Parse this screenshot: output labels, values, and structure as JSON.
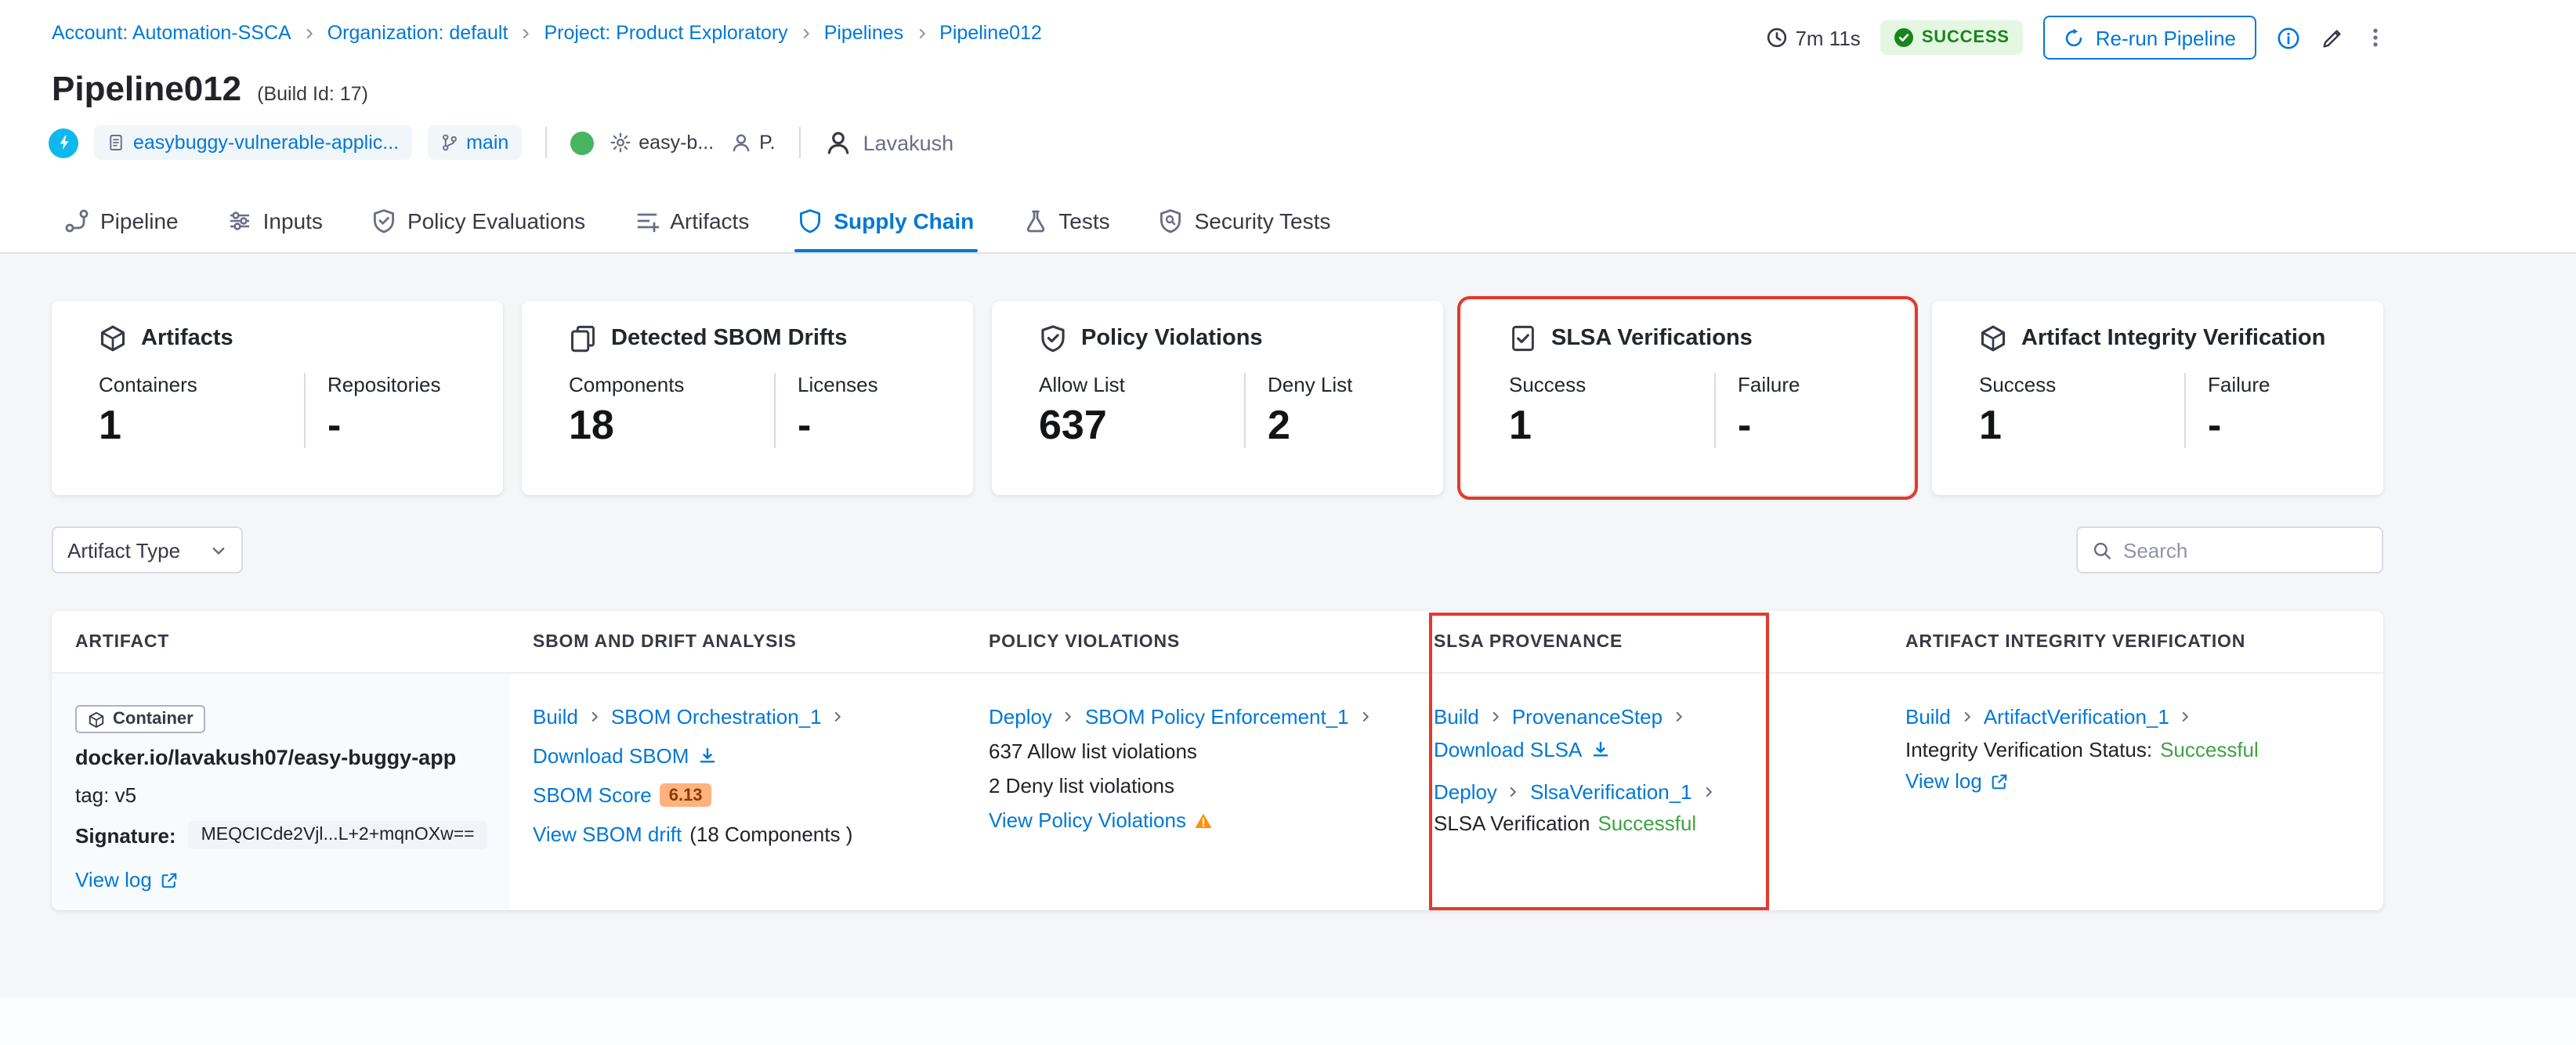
{
  "breadcrumb": {
    "items": [
      {
        "label": "Account: Automation-SSCA"
      },
      {
        "label": "Organization: default"
      },
      {
        "label": "Project: Product Exploratory"
      },
      {
        "label": "Pipelines"
      },
      {
        "label": "Pipeline012"
      }
    ]
  },
  "header": {
    "duration": "7m 11s",
    "status": "SUCCESS",
    "rerun_label": "Re-run Pipeline",
    "title": "Pipeline012",
    "build_id": "(Build Id: 17)"
  },
  "meta": {
    "repo": "easybuggy-vulnerable-applic...",
    "branch": "main",
    "service": "easy-b...",
    "delegate": "P.",
    "user": "Lavakush"
  },
  "tabs": [
    {
      "label": "Pipeline"
    },
    {
      "label": "Inputs"
    },
    {
      "label": "Policy Evaluations"
    },
    {
      "label": "Artifacts"
    },
    {
      "label": "Supply Chain"
    },
    {
      "label": "Tests"
    },
    {
      "label": "Security Tests"
    }
  ],
  "summary_cards": [
    {
      "title": "Artifacts",
      "metric1_label": "Containers",
      "metric1_value": "1",
      "metric2_label": "Repositories",
      "metric2_value": "-"
    },
    {
      "title": "Detected SBOM Drifts",
      "metric1_label": "Components",
      "metric1_value": "18",
      "metric2_label": "Licenses",
      "metric2_value": "-"
    },
    {
      "title": "Policy Violations",
      "metric1_label": "Allow List",
      "metric1_value": "637",
      "metric2_label": "Deny List",
      "metric2_value": "2"
    },
    {
      "title": "SLSA Verifications",
      "metric1_label": "Success",
      "metric1_value": "1",
      "metric2_label": "Failure",
      "metric2_value": "-"
    },
    {
      "title": "Artifact Integrity Verification",
      "metric1_label": "Success",
      "metric1_value": "1",
      "metric2_label": "Failure",
      "metric2_value": "-"
    }
  ],
  "filters": {
    "artifact_type_label": "Artifact Type",
    "search_placeholder": "Search"
  },
  "table": {
    "headers": [
      "Artifact",
      "SBOM and Drift Analysis",
      "Policy Violations",
      "SLSA Provenance",
      "Artifact Integrity Verification"
    ],
    "row": {
      "artifact": {
        "type_badge": "Container",
        "image": "docker.io/lavakush07/easy-buggy-app",
        "tag": "tag: v5",
        "signature_label": "Signature:",
        "signature_value": "MEQCICde2Vjl...L+2+mqnOXw==",
        "view_log": "View log"
      },
      "sbom": {
        "stage": "Build",
        "step": "SBOM Orchestration_1",
        "download": "Download SBOM",
        "score_label": "SBOM Score",
        "score_value": "6.13",
        "drift_link": "View SBOM drift",
        "drift_suffix": "(18 Components )"
      },
      "policy": {
        "stage": "Deploy",
        "step": "SBOM Policy Enforcement_1",
        "allow_text": "637 Allow list violations",
        "deny_text": "2 Deny list violations",
        "view_link": "View Policy Violations"
      },
      "slsa": {
        "build_stage": "Build",
        "build_step": "ProvenanceStep",
        "download": "Download SLSA",
        "deploy_stage": "Deploy",
        "deploy_step": "SlsaVerification_1",
        "verification_label": "SLSA Verification",
        "verification_status": "Successful"
      },
      "integrity": {
        "stage": "Build",
        "step": "ArtifactVerification_1",
        "status_label": "Integrity Verification Status:",
        "status_value": "Successful",
        "view_log": "View log"
      }
    }
  },
  "colors": {
    "primary_blue": "#0278D5",
    "success_badge_bg": "#E4F7E1",
    "success_badge_text": "#1B841D",
    "success_text": "#3FA243",
    "annotation_red": "#E23A2B",
    "score_badge_bg": "#FFB27D"
  }
}
